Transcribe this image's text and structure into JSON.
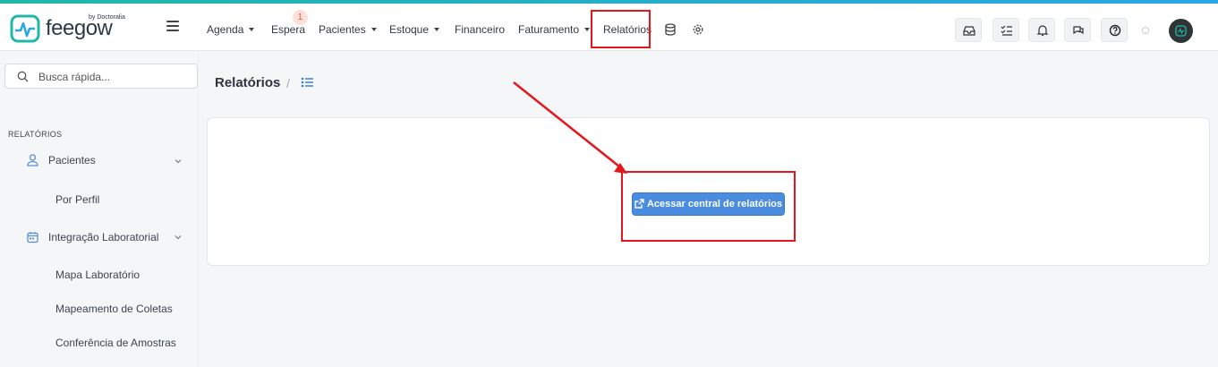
{
  "brand": {
    "name": "feegow",
    "sub": "by Doctoralia"
  },
  "nav": {
    "agenda": "Agenda",
    "espera": "Espera",
    "espera_badge": "1",
    "pacientes": "Pacientes",
    "estoque": "Estoque",
    "financeiro": "Financeiro",
    "faturamento": "Faturamento",
    "relatorios": "Relatórios"
  },
  "search": {
    "placeholder": "Busca rápida..."
  },
  "sidebar": {
    "section": "RELATÓRIOS",
    "pacientes": "Pacientes",
    "por_perfil": "Por Perfil",
    "integracao": "Integração Laboratorial",
    "mapa": "Mapa Laboratório",
    "mapeamento": "Mapeamento de Coletas",
    "conferencia": "Conferência de Amostras"
  },
  "main": {
    "title": "Relatórios",
    "separator": "/",
    "cta_label": "Acessar central de relatórios"
  },
  "colors": {
    "accent": "#4a8ce0",
    "highlight": "#e4161e",
    "brand": "#1fb8a8"
  },
  "icons": [
    "menu-icon",
    "database-icon",
    "gear-icon",
    "inbox-icon",
    "tasks-icon",
    "bell-icon",
    "chat-icon",
    "help-icon",
    "search-icon",
    "user-icon",
    "calendar-icon",
    "chevron-down-icon",
    "list-icon",
    "external-link-icon"
  ]
}
